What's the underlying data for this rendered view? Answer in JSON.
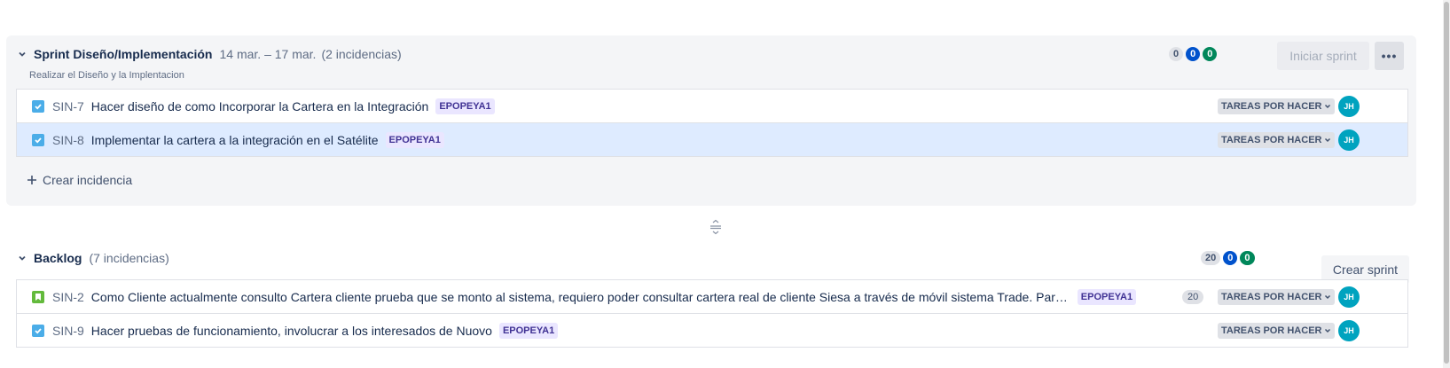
{
  "sprint": {
    "title": "Sprint Diseño/Implementación",
    "dates": "14 mar. – 17 mar.",
    "count_text": "(2 incidencias)",
    "goal": "Realizar el Diseño y la Implentacion",
    "counts": {
      "todo": "0",
      "in_progress": "0",
      "done": "0"
    },
    "start_label": "Iniciar sprint",
    "more_label": "•••",
    "create_issue_label": "Crear incidencia",
    "issues": [
      {
        "key": "SIN-7",
        "summary": "Hacer diseño de como Incorporar la Cartera en la Integración",
        "epic": "EPOPEYA1",
        "status": "TAREAS POR HACER",
        "assignee": "JH",
        "type": "task"
      },
      {
        "key": "SIN-8",
        "summary": "Implementar la cartera a la integración en el Satélite",
        "epic": "EPOPEYA1",
        "status": "TAREAS POR HACER",
        "assignee": "JH",
        "type": "task"
      }
    ]
  },
  "backlog": {
    "title": "Backlog",
    "count_text": "(7 incidencias)",
    "counts": {
      "todo": "20",
      "in_progress": "0",
      "done": "0"
    },
    "create_sprint_label": "Crear sprint",
    "issues": [
      {
        "key": "SIN-2",
        "summary": "Como Cliente actualmente consulto Cartera cliente prueba que se monto al sistema, requiero poder consultar cartera real de cliente Siesa a través de móvil sistema Trade. Para ver la cartera del cliente",
        "epic": "EPOPEYA1",
        "estimate": "20",
        "status": "TAREAS POR HACER",
        "assignee": "JH",
        "type": "story"
      },
      {
        "key": "SIN-9",
        "summary": "Hacer pruebas de funcionamiento, involucrar a los interesados de Nuovo",
        "epic": "EPOPEYA1",
        "status": "TAREAS POR HACER",
        "assignee": "JH",
        "type": "task"
      }
    ]
  },
  "colors": {
    "task": "#4bade8",
    "story": "#63ba3c",
    "epic_bg": "#eae6ff",
    "epic_text": "#403294",
    "avatar": "#00a3bf",
    "selected_row": "#deebff"
  }
}
